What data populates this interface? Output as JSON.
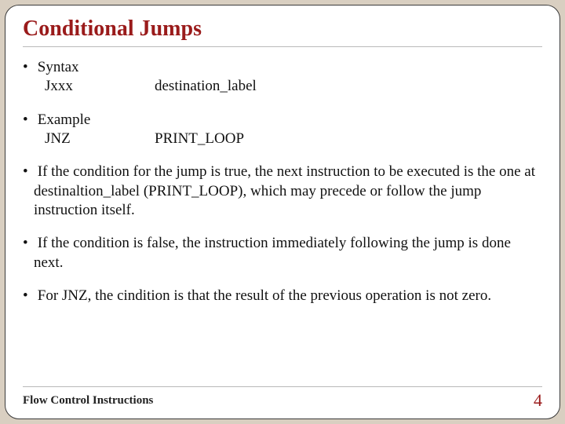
{
  "slide": {
    "title": "Conditional Jumps",
    "bullets": {
      "b1": {
        "label": "Syntax",
        "left": "Jxxx",
        "right": "destination_label"
      },
      "b2": {
        "label": "Example",
        "left": "JNZ",
        "right": "PRINT_LOOP"
      },
      "b3": "If the condition for the jump is true, the next instruction to be executed is the one at destinaltion_label (PRINT_LOOP), which may precede or follow the jump instruction itself.",
      "b4": "If the condition is false, the instruction immediately following the jump is done next.",
      "b5": "For JNZ, the cindition is that the result of the previous operation is not zero."
    },
    "footer": {
      "left": "Flow Control Instructions",
      "page": "4"
    }
  }
}
